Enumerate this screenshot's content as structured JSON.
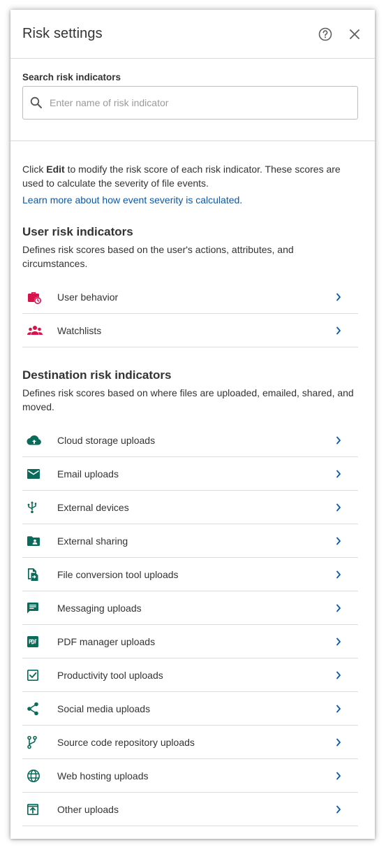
{
  "header": {
    "title": "Risk settings",
    "help_icon": "help-circle-icon",
    "close_icon": "close-icon"
  },
  "search": {
    "label": "Search risk indicators",
    "placeholder": "Enter name of risk indicator",
    "value": ""
  },
  "intro": {
    "text_before": "Click ",
    "bold": "Edit",
    "text_after": " to modify the risk score of each risk indicator. These scores are used to calculate the severity of file events.",
    "link": "Learn more about how event severity is calculated."
  },
  "user_section": {
    "title": "User risk indicators",
    "description": "Defines risk scores based on the user's actions, attributes, and circumstances.",
    "items": [
      {
        "label": "User behavior",
        "icon": "briefcase-clock-icon"
      },
      {
        "label": "Watchlists",
        "icon": "people-icon"
      }
    ]
  },
  "destination_section": {
    "title": "Destination risk indicators",
    "description": "Defines risk scores based on where files are uploaded, emailed, shared, and moved.",
    "items": [
      {
        "label": "Cloud storage uploads",
        "icon": "cloud-upload-icon"
      },
      {
        "label": "Email uploads",
        "icon": "email-icon"
      },
      {
        "label": "External devices",
        "icon": "usb-icon"
      },
      {
        "label": "External sharing",
        "icon": "shared-folder-icon"
      },
      {
        "label": "File conversion tool uploads",
        "icon": "file-convert-icon"
      },
      {
        "label": "Messaging uploads",
        "icon": "message-icon"
      },
      {
        "label": "PDF manager uploads",
        "icon": "pdf-icon"
      },
      {
        "label": "Productivity tool uploads",
        "icon": "checkbox-icon"
      },
      {
        "label": "Social media uploads",
        "icon": "share-icon"
      },
      {
        "label": "Source code repository uploads",
        "icon": "branch-icon"
      },
      {
        "label": "Web hosting uploads",
        "icon": "globe-icon"
      },
      {
        "label": "Other uploads",
        "icon": "upload-box-icon"
      }
    ]
  },
  "colors": {
    "user_icon": "#d6134d",
    "destination_icon": "#0b6b5a",
    "link": "#0a58a8",
    "chevron": "#0a58a8"
  }
}
